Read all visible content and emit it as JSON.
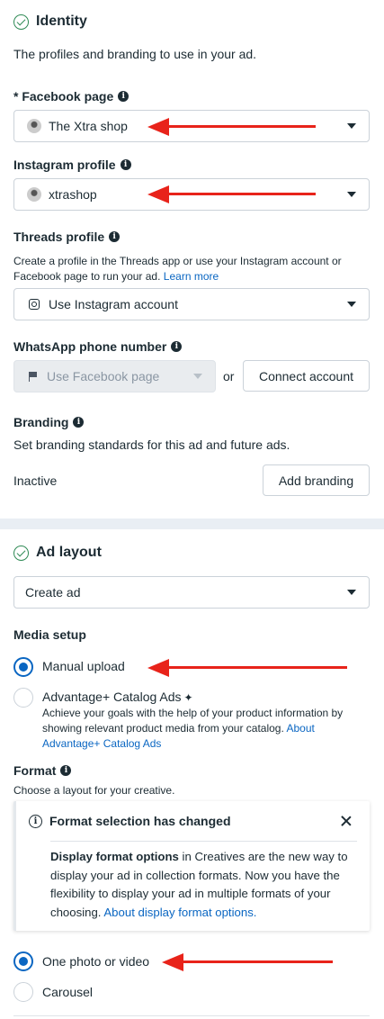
{
  "identity": {
    "title": "Identity",
    "subtitle": "The profiles and branding to use in your ad.",
    "facebook_page": {
      "label": "* Facebook page",
      "value": "The Xtra shop"
    },
    "instagram_profile": {
      "label": "Instagram profile",
      "value": "xtrashop"
    },
    "threads_profile": {
      "label": "Threads profile",
      "help": "Create a profile in the Threads app or use your Instagram account or Facebook page to run your ad.",
      "link": "Learn more",
      "value": "Use Instagram account"
    },
    "whatsapp": {
      "label": "WhatsApp phone number",
      "value": "Use Facebook page",
      "or": "or",
      "connect_button": "Connect account"
    },
    "branding": {
      "label": "Branding",
      "help": "Set branding standards for this ad and future ads.",
      "status": "Inactive",
      "button": "Add branding"
    }
  },
  "ad_layout": {
    "title": "Ad layout",
    "create_select": "Create ad",
    "media_setup": {
      "label": "Media setup",
      "options": [
        {
          "label": "Manual upload",
          "selected": true
        },
        {
          "label": "Advantage+ Catalog Ads",
          "selected": false,
          "description": "Achieve your goals with the help of your product information by showing relevant product media from your catalog.",
          "link": "About Advantage+ Catalog Ads"
        }
      ]
    },
    "format": {
      "label": "Format",
      "help": "Choose a layout for your creative.",
      "notice": {
        "title": "Format selection has changed",
        "body_bold": "Display format options",
        "body": " in Creatives are the new way to display your ad in collection formats. Now you have the flexibility to display your ad in multiple formats of your choosing. ",
        "link": "About display format options."
      },
      "options": [
        {
          "label": "One photo or video",
          "selected": true
        },
        {
          "label": "Carousel",
          "selected": false
        }
      ]
    }
  },
  "colors": {
    "accent": "#0a66c2",
    "success": "#2f8a55",
    "annotation_arrow": "#e8231a"
  },
  "icons": [
    "check-circle-icon",
    "info-icon",
    "avatar-icon",
    "instagram-icon",
    "flag-icon",
    "chevron-down-icon",
    "sparkle-icon",
    "close-icon"
  ]
}
